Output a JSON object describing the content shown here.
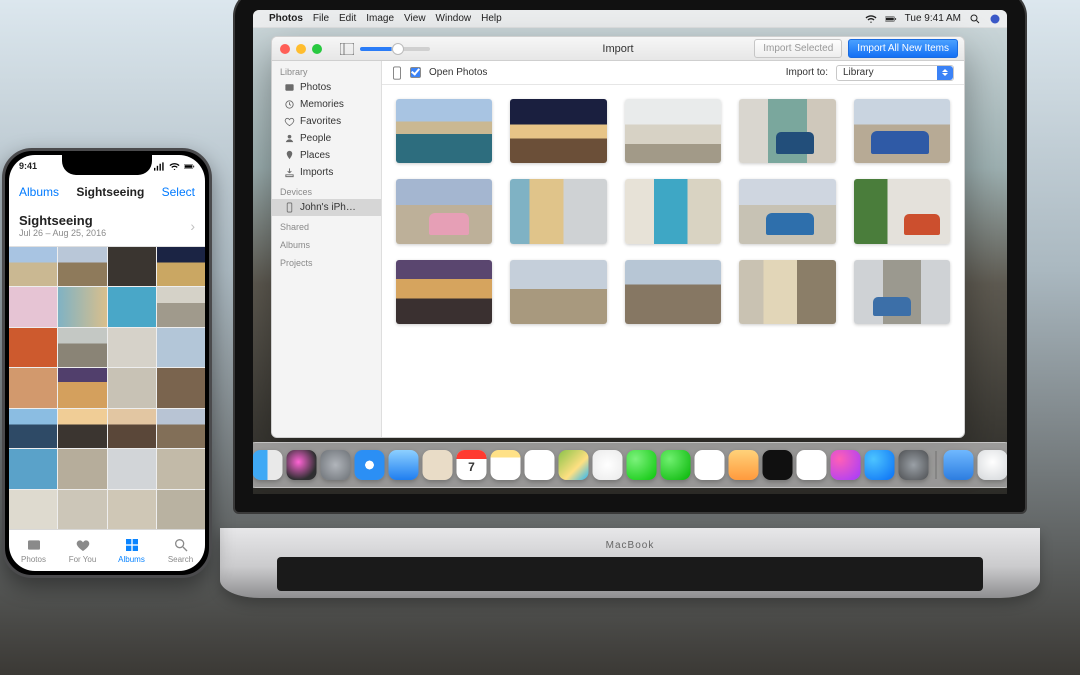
{
  "menubar": {
    "app": "Photos",
    "items": [
      "File",
      "Edit",
      "Image",
      "View",
      "Window",
      "Help"
    ],
    "clock": "Tue 9:41 AM"
  },
  "window": {
    "title": "Import",
    "btn_selected": "Import Selected",
    "btn_all": "Import All New Items",
    "open_photos_label": "Open Photos",
    "import_to_label": "Import to:",
    "import_to_value": "Library"
  },
  "sidebar": {
    "section_library": "Library",
    "items": [
      "Photos",
      "Memories",
      "Favorites",
      "People",
      "Places",
      "Imports"
    ],
    "section_devices": "Devices",
    "device": "John's iPh…",
    "section_shared": "Shared",
    "section_albums": "Albums",
    "section_projects": "Projects"
  },
  "laptop_label": "MacBook",
  "dock": {
    "calendar_day": "7"
  },
  "iphone": {
    "time": "9:41",
    "back": "Albums",
    "title": "Sightseeing",
    "select": "Select",
    "album_name": "Sightseeing",
    "album_dates": "Jul 26 – Aug 25, 2016",
    "tabs": [
      "Photos",
      "For You",
      "Albums",
      "Search"
    ]
  }
}
